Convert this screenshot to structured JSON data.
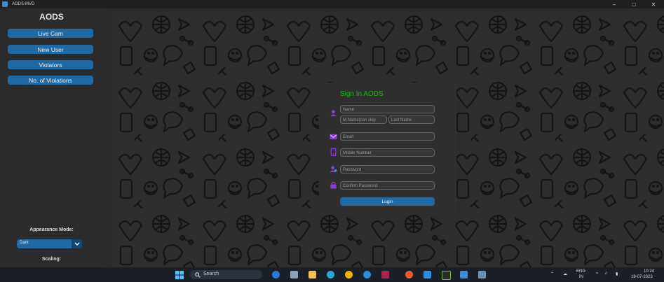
{
  "window": {
    "title": "AODS-MVD",
    "controls": [
      "minimize-icon",
      "maximize-icon",
      "close-icon"
    ]
  },
  "sidebar": {
    "logo": "AODS",
    "buttons": [
      {
        "label": "Live Cam"
      },
      {
        "label": "New User"
      },
      {
        "label": "Violators"
      },
      {
        "label": "No. of Violations"
      }
    ],
    "appearance_label": "Appearance Mode:",
    "appearance_value": "Dark",
    "scaling_label": "Scaling:"
  },
  "signin": {
    "heading": "Sign In AODS",
    "name_placeholder": "Name",
    "middle_name_placeholder": "M.Name(can skip",
    "last_name_placeholder": "Last Name",
    "email_placeholder": "Email",
    "mobile_placeholder": "Mobile Number",
    "password_placeholder": "Password",
    "confirm_password_placeholder": "Confirm Password",
    "login_label": "Login"
  },
  "taskbar": {
    "search_label": "Search",
    "lang_top": "ENG",
    "lang_bottom": "IN",
    "time": "10:24",
    "date": "18-07-2023"
  },
  "colors": {
    "accent": "#1f6aa5",
    "heading": "#1db51d",
    "icon_purple": "#8a3fd1"
  }
}
